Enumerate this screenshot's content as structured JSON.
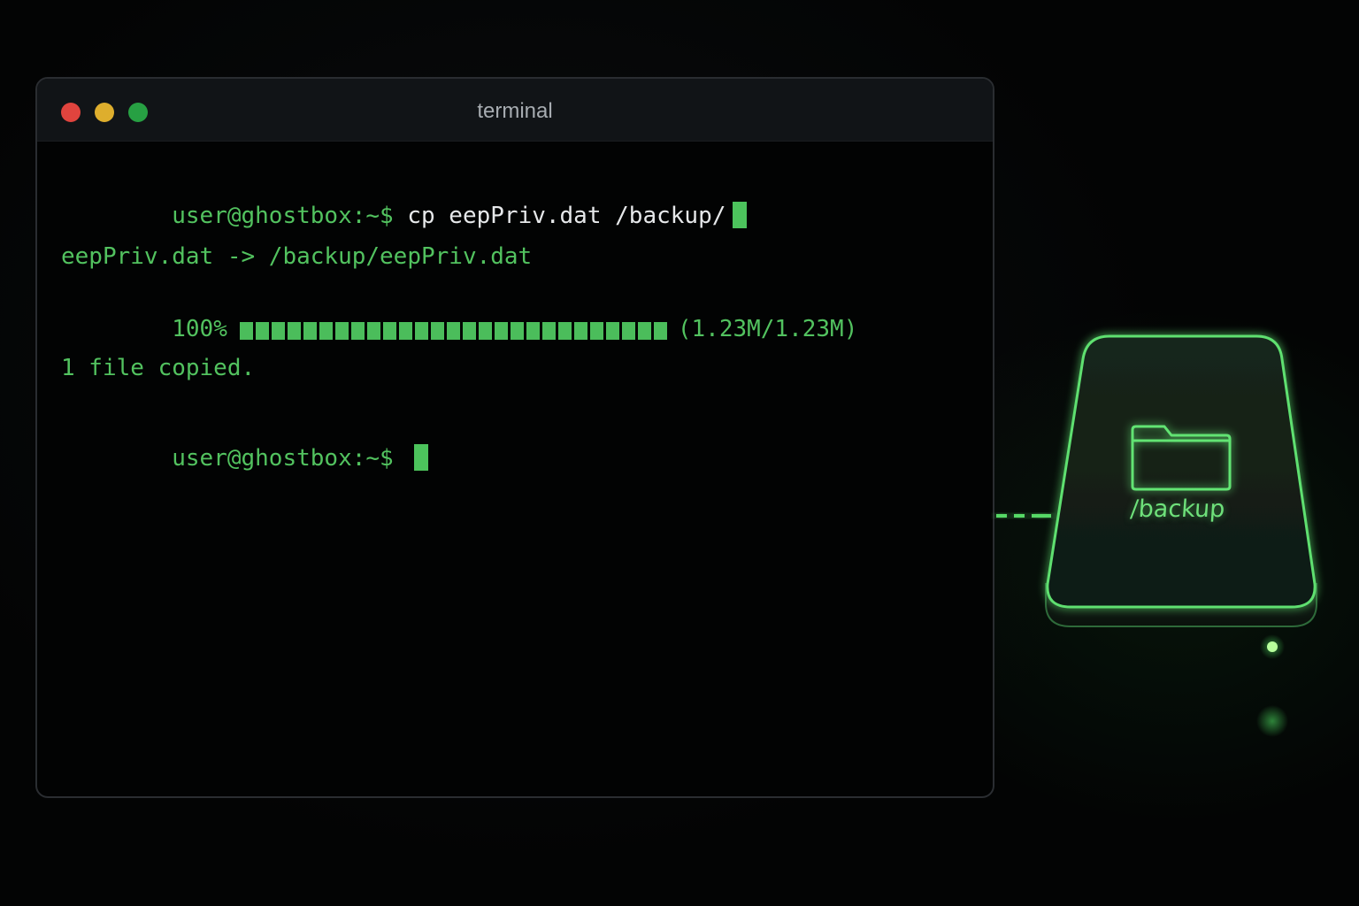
{
  "window": {
    "title": "terminal"
  },
  "terminal": {
    "line1": {
      "prompt": "user@ghostbox:~$",
      "command": "cp eepPriv.dat /backup/"
    },
    "line2": "eepPriv.dat -> /backup/eepPriv.dat",
    "progress": {
      "percent_label": "100%",
      "fraction": 1.0,
      "size_label": "(1.23M/1.23M)"
    },
    "line4": "1 file copied.",
    "line5": {
      "prompt": "user@ghostbox:~$"
    }
  },
  "drive": {
    "label": "/backup",
    "icon": "folder-icon"
  },
  "colors": {
    "accent_green": "#52c25f",
    "traffic_red": "#e0443e",
    "traffic_yellow": "#deae2d",
    "traffic_green": "#27a043"
  }
}
